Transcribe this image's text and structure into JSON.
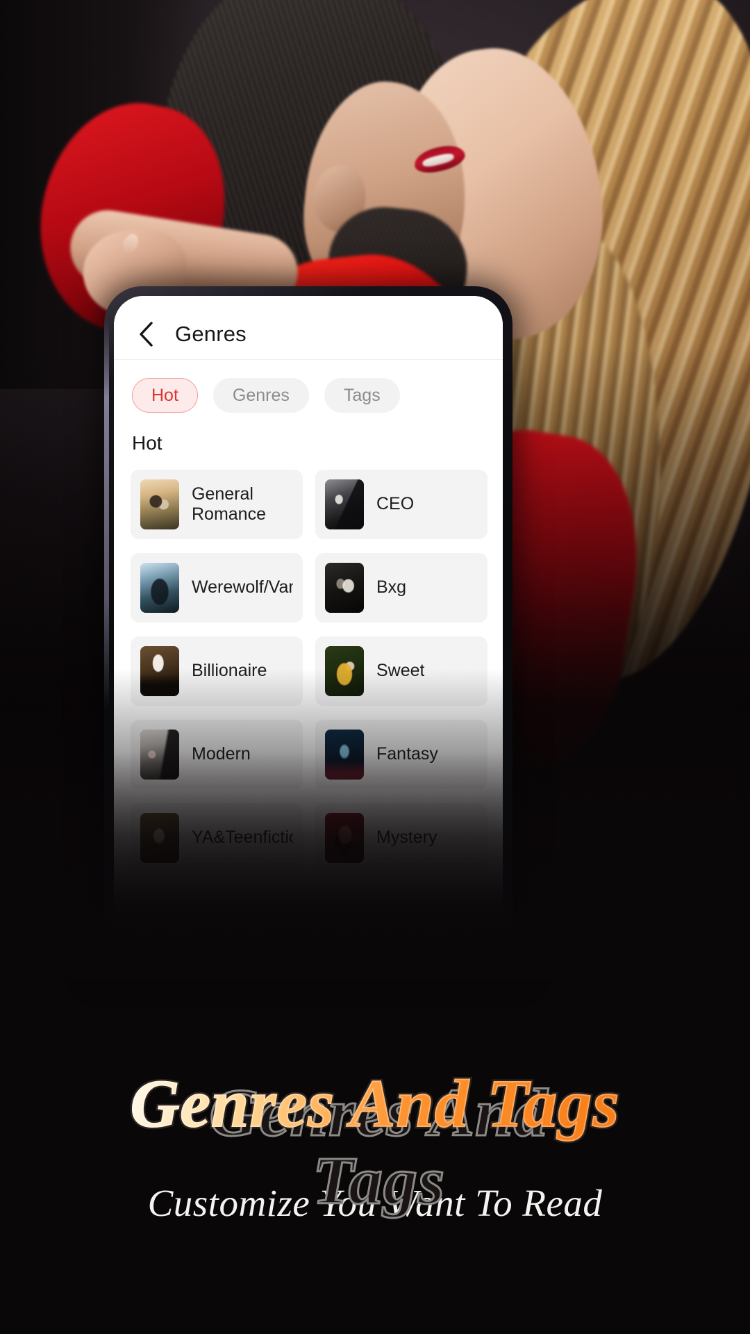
{
  "background": {
    "description": "romantic-couple-photo",
    "accent_red": "#e2342f"
  },
  "phone": {
    "appbar": {
      "back_icon": "chevron-left-icon",
      "title": "Genres"
    },
    "chips": [
      {
        "label": "Hot",
        "active": true
      },
      {
        "label": "Genres",
        "active": false
      },
      {
        "label": "Tags",
        "active": false
      }
    ],
    "section": {
      "title": "Hot"
    },
    "genres": [
      {
        "label": "General Romance",
        "thumb": "couple-dancing-field-thumb"
      },
      {
        "label": "CEO",
        "thumb": "man-suit-chair-thumb"
      },
      {
        "label": "Werewolf/Vampire",
        "thumb": "dark-fantasy-woman-thumb"
      },
      {
        "label": "Bxg",
        "thumb": "masked-couple-thumb"
      },
      {
        "label": "Billionaire",
        "thumb": "man-white-shirt-thumb"
      },
      {
        "label": "Sweet",
        "thumb": "woman-yellow-dress-thumb"
      },
      {
        "label": "Modern",
        "thumb": "wedding-crowd-thumb"
      },
      {
        "label": "Fantasy",
        "thumb": "neon-blue-figure-thumb"
      },
      {
        "label": "YA&Teenfiction",
        "thumb": "teen-couple-thumb"
      },
      {
        "label": "Mystery",
        "thumb": "red-smoke-figure-thumb"
      }
    ]
  },
  "promo": {
    "headline": "Genres And Tags",
    "subtitle": "Customize You Want To Read",
    "headline_gradient_start": "#fff9ec",
    "headline_gradient_end": "#f87d19"
  }
}
